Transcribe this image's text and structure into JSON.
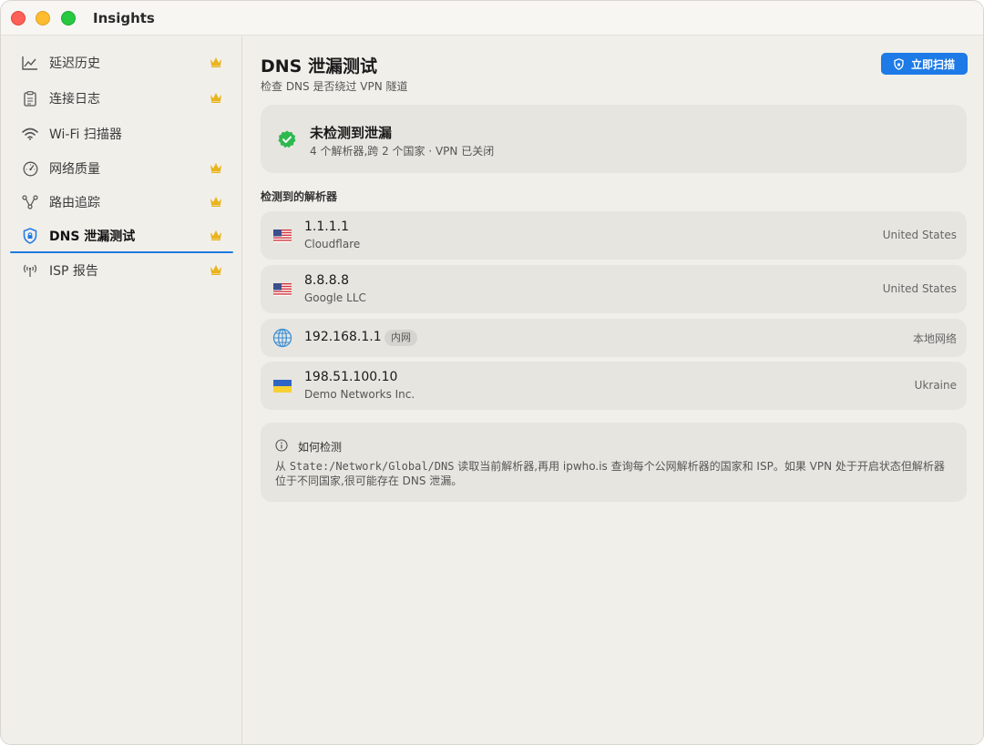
{
  "window": {
    "title": "Insights"
  },
  "sidebar": {
    "items": [
      {
        "label": "延迟历史",
        "icon": "chart-line-icon",
        "premium": true,
        "active": false
      },
      {
        "label": "连接日志",
        "icon": "clipboard-icon",
        "premium": true,
        "active": false
      },
      {
        "label": "Wi-Fi 扫描器",
        "icon": "wifi-icon",
        "premium": false,
        "active": false
      },
      {
        "label": "网络质量",
        "icon": "gauge-icon",
        "premium": true,
        "active": false
      },
      {
        "label": "路由追踪",
        "icon": "route-icon",
        "premium": true,
        "active": false
      },
      {
        "label": "DNS 泄漏测试",
        "icon": "shield-lock-icon",
        "premium": true,
        "active": true
      },
      {
        "label": "ISP 报告",
        "icon": "antenna-icon",
        "premium": true,
        "active": false
      }
    ]
  },
  "main": {
    "title": "DNS 泄漏测试",
    "subtitle": "检查 DNS 是否绕过 VPN 隧道",
    "scan_button": "立即扫描",
    "status": {
      "title": "未检测到泄漏",
      "detail": "4 个解析器,跨 2 个国家 · VPN 已关闭"
    },
    "resolvers_title": "检测到的解析器",
    "resolvers": [
      {
        "ip": "1.1.1.1",
        "org": "Cloudflare",
        "country": "United States",
        "flag": "us-flag-icon"
      },
      {
        "ip": "8.8.8.8",
        "org": "Google LLC",
        "country": "United States",
        "flag": "us-flag-icon"
      },
      {
        "ip": "192.168.1.1",
        "badge": "内网",
        "country": "本地网络",
        "flag": "globe-icon"
      },
      {
        "ip": "198.51.100.10",
        "org": "Demo Networks Inc.",
        "country": "Ukraine",
        "flag": "ua-flag-icon"
      }
    ],
    "info": {
      "title": "如何检测",
      "text_prefix": "从 ",
      "text_code": "State:/Network/Global/DNS",
      "text_suffix": " 读取当前解析器,再用 ipwho.is 查询每个公网解析器的国家和 ISP。如果 VPN 处于开启状态但解析器位于不同国家,很可能存在 DNS 泄漏。"
    }
  },
  "colors": {
    "accent": "#1d7ae6",
    "success": "#2fb84f",
    "crown": "#e9b41c"
  }
}
